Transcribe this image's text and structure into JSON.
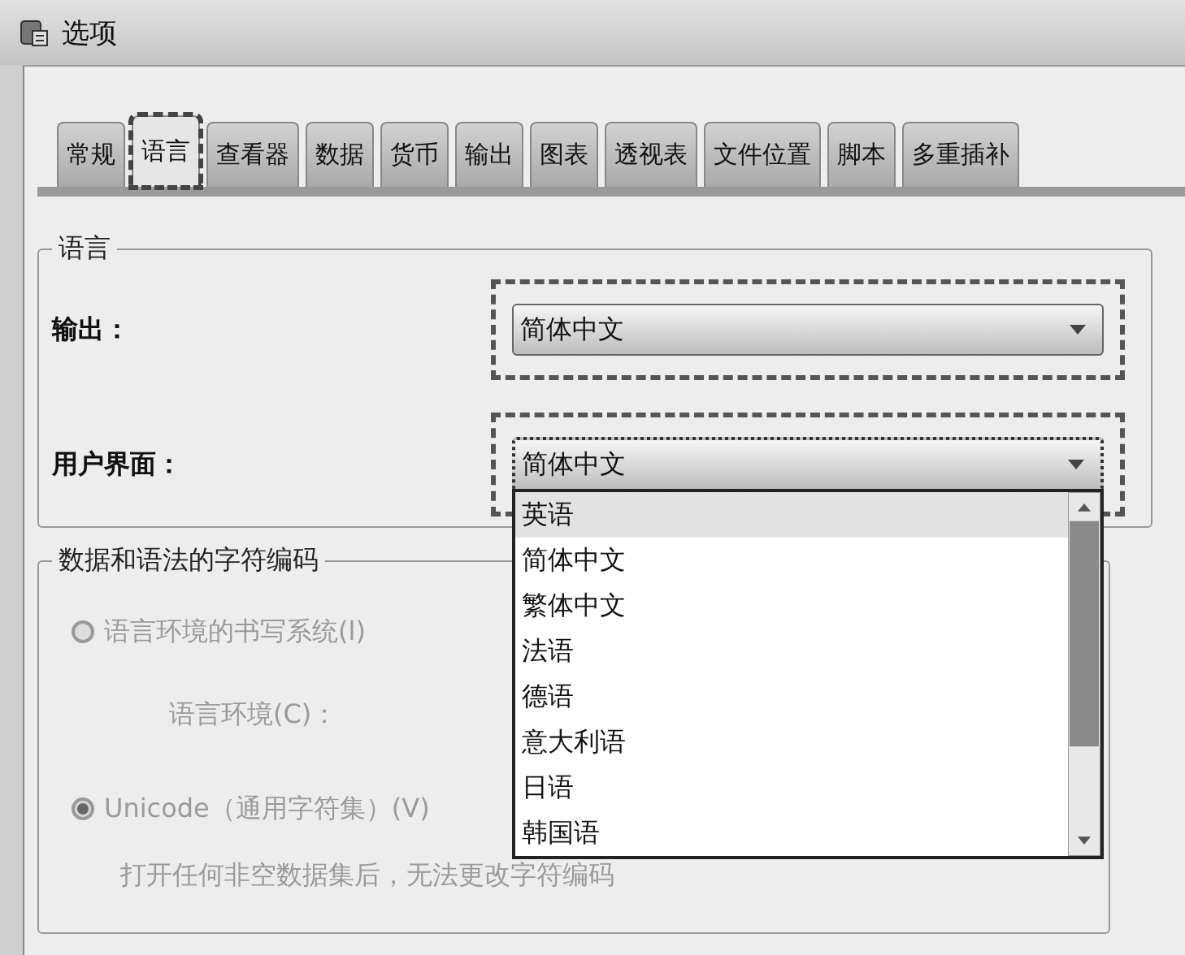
{
  "window": {
    "title": "选项"
  },
  "tabs": [
    {
      "label": "常规",
      "selected": false
    },
    {
      "label": "语言",
      "selected": true
    },
    {
      "label": "查看器",
      "selected": false
    },
    {
      "label": "数据",
      "selected": false
    },
    {
      "label": "货币",
      "selected": false
    },
    {
      "label": "输出",
      "selected": false
    },
    {
      "label": "图表",
      "selected": false
    },
    {
      "label": "透视表",
      "selected": false
    },
    {
      "label": "文件位置",
      "selected": false
    },
    {
      "label": "脚本",
      "selected": false
    },
    {
      "label": "多重插补",
      "selected": false
    }
  ],
  "language_group": {
    "title": "语言",
    "output": {
      "label": "输出：",
      "value": "简体中文"
    },
    "user_interface": {
      "label": "用户界面：",
      "value": "简体中文",
      "expanded": true,
      "options": [
        {
          "label": "英语",
          "highlighted": true
        },
        {
          "label": "简体中文",
          "highlighted": false
        },
        {
          "label": "繁体中文",
          "highlighted": false
        },
        {
          "label": "法语",
          "highlighted": false
        },
        {
          "label": "德语",
          "highlighted": false
        },
        {
          "label": "意大利语",
          "highlighted": false
        },
        {
          "label": "日语",
          "highlighted": false
        },
        {
          "label": "韩国语",
          "highlighted": false
        }
      ]
    }
  },
  "encoding_group": {
    "title": "数据和语法的字符编码",
    "disabled": true,
    "radios": [
      {
        "label": "语言环境的书写系统(l)",
        "selected": false
      },
      {
        "label": "Unicode（通用字符集）(V)",
        "selected": true
      }
    ],
    "locale_label": "语言环境(C)：",
    "note": "打开任何非空数据集后，无法更改字符编码"
  }
}
